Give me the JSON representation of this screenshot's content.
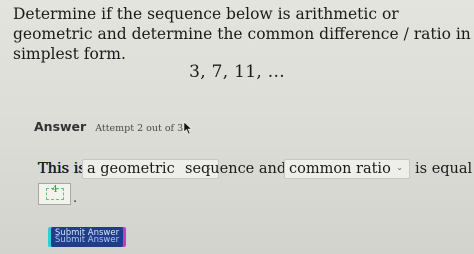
{
  "question": {
    "text": "Determine if the sequence below is arithmetic or geometric and determine the common difference / ratio in simplest form.",
    "sequence": "3, 7, 11, ..."
  },
  "answer": {
    "label": "Answer",
    "attempt": "Attempt 2 out of 3"
  },
  "fill": {
    "prefix": "This is",
    "type_select_value": "a geometric",
    "middle": "sequence and the",
    "measure_select_value": "common ratio",
    "suffix": "is equal to",
    "answer_value": "4",
    "period": "."
  },
  "submit": {
    "label": "Submit Answer"
  },
  "icons": {
    "chevron": "chevron-down-icon",
    "cursor": "mouse-pointer-icon"
  },
  "colors": {
    "background": "#dcdcd6",
    "submit_bg": "#1f3d8a",
    "input_green": "#2f9e2f"
  }
}
